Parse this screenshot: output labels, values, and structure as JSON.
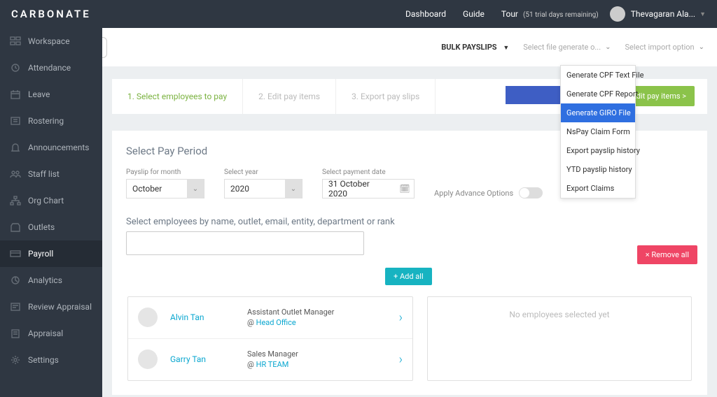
{
  "brand": "CARBONATE",
  "topnav": {
    "dashboard": "Dashboard",
    "guide": "Guide",
    "tour": "Tour",
    "trial": "(51 trial days remaining)",
    "username": "Thevagaran Ala..."
  },
  "sidebar": {
    "items": [
      {
        "label": "Workspace",
        "name": "workspace"
      },
      {
        "label": "Attendance",
        "name": "attendance"
      },
      {
        "label": "Leave",
        "name": "leave"
      },
      {
        "label": "Rostering",
        "name": "rostering"
      },
      {
        "label": "Announcements",
        "name": "announcements"
      },
      {
        "label": "Staff list",
        "name": "staff-list"
      },
      {
        "label": "Org Chart",
        "name": "org-chart"
      },
      {
        "label": "Outlets",
        "name": "outlets"
      },
      {
        "label": "Payroll",
        "name": "payroll"
      },
      {
        "label": "Analytics",
        "name": "analytics"
      },
      {
        "label": "Review Appraisal",
        "name": "review-appraisal"
      },
      {
        "label": "Appraisal",
        "name": "appraisal"
      },
      {
        "label": "Settings",
        "name": "settings"
      }
    ],
    "active_index": 8
  },
  "toolbar": {
    "bulk": "BULK PAYSLIPS",
    "generate_dd": "Select file generate o...",
    "import_dd": "Select import option"
  },
  "generate_options": [
    "Generate CPF Text File",
    "Generate CPF Report",
    "Generate GIRO File",
    "NsPay Claim Form",
    "Export payslip history",
    "YTD payslip history",
    "Export Claims"
  ],
  "generate_highlight_index": 2,
  "steps": {
    "s1": "1. Select employees to pay",
    "s2": "2. Edit pay items",
    "s3": "3. Export pay slips",
    "edit_btn": "Edit pay items >"
  },
  "period": {
    "title": "Select Pay Period",
    "month_label": "Payslip for month",
    "month_value": "October",
    "year_label": "Select year",
    "year_value": "2020",
    "date_label": "Select payment date",
    "date_value": "31 October 2020",
    "adv": "Apply Advance Options"
  },
  "search": {
    "label": "Select employees by name, outlet, email, entity, department or rank"
  },
  "buttons": {
    "remove_all": "× Remove all",
    "add_all": "+ Add all"
  },
  "employees": [
    {
      "name": "Alvin Tan",
      "role": "Assistant Outlet Manager",
      "at": "@ ",
      "loc": "Head Office"
    },
    {
      "name": "Garry Tan",
      "role": "Sales Manager",
      "at": "@ ",
      "loc": "HR TEAM"
    }
  ],
  "right_pane": "No employees selected yet"
}
